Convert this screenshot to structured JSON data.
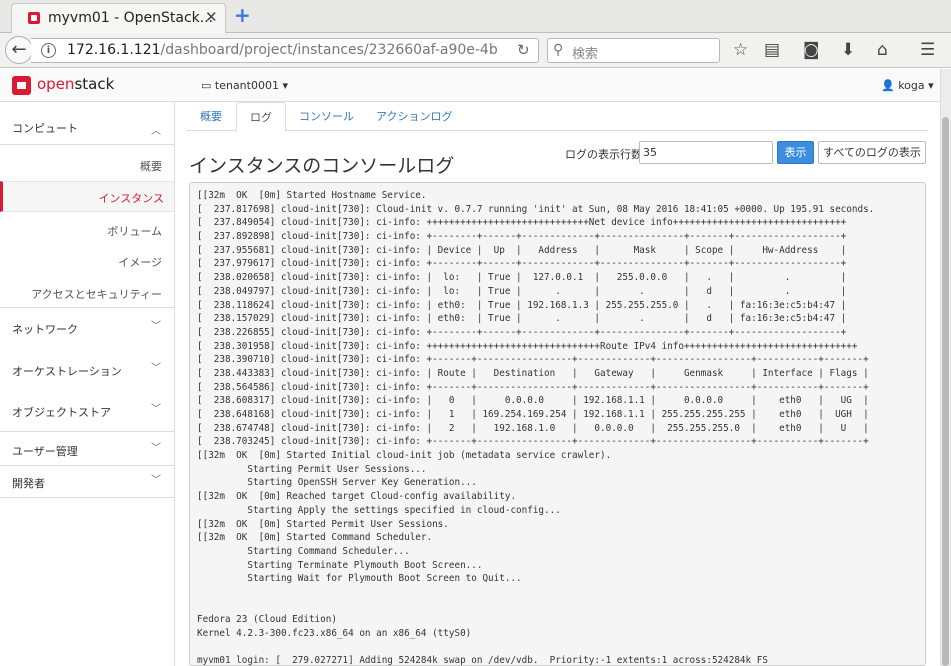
{
  "browser": {
    "tab_title": "myvm01 - OpenStack...",
    "close_glyph": "✕",
    "newtab_glyph": "+",
    "url_host": "172.16.1.121",
    "url_path": "/dashboard/project/instances/232660af-a90e-4b",
    "search_placeholder": "検索",
    "icons": [
      "star-icon",
      "reading-list-icon",
      "pocket-icon",
      "download-icon",
      "home-icon",
      "menu-icon"
    ]
  },
  "header": {
    "brand_prefix": "open",
    "brand_suffix": "stack",
    "tenant": "tenant0001 ▾",
    "user": "koga ▾"
  },
  "sidebar": {
    "compute": "コンピュート",
    "overview": "概要",
    "instances": "インスタンス",
    "volumes": "ボリューム",
    "images": "イメージ",
    "access": "アクセスとセキュリティー",
    "network": "ネットワーク",
    "orchestration": "オーケストレーション",
    "object_store": "オブジェクトストア",
    "identity": "ユーザー管理",
    "developer": "開発者"
  },
  "tabs": {
    "overview": "概要",
    "log": "ログ",
    "console": "コンソール",
    "action_log": "アクションログ"
  },
  "page": {
    "title": "インスタンスのコンソールログ",
    "lines_label": "ログの表示行数",
    "lines_value": "35",
    "show_button": "表示",
    "all_button": "すべてのログの表示"
  },
  "console_log": "[[32m  OK  [0m] Started Hostname Service.\n[  237.817698] cloud-init[730]: Cloud-init v. 0.7.7 running 'init' at Sun, 08 May 2016 18:41:05 +0000. Up 195.91 seconds.\n[  237.849054] cloud-init[730]: ci-info: +++++++++++++++++++++++++++++Net device info+++++++++++++++++++++++++++++++\n[  237.892898] cloud-init[730]: ci-info: +--------+------+-------------+---------------+-------+-------------------+\n[  237.955681] cloud-init[730]: ci-info: | Device |  Up  |   Address   |      Mask     | Scope |     Hw-Address    |\n[  237.979617] cloud-init[730]: ci-info: +--------+------+-------------+---------------+-------+-------------------+\n[  238.020658] cloud-init[730]: ci-info: |  lo:   | True |  127.0.0.1  |   255.0.0.0   |   .   |         .         |\n[  238.049797] cloud-init[730]: ci-info: |  lo:   | True |      .      |       .       |   d   |         .         |\n[  238.118624] cloud-init[730]: ci-info: | eth0:  | True | 192.168.1.3 | 255.255.255.0 |   .   | fa:16:3e:c5:b4:47 |\n[  238.157029] cloud-init[730]: ci-info: | eth0:  | True |      .      |       .       |   d   | fa:16:3e:c5:b4:47 |\n[  238.226855] cloud-init[730]: ci-info: +--------+------+-------------+---------------+-------+-------------------+\n[  238.301958] cloud-init[730]: ci-info: +++++++++++++++++++++++++++++++Route IPv4 info+++++++++++++++++++++++++++++++\n[  238.390710] cloud-init[730]: ci-info: +-------+-----------------+-------------+-----------------+-----------+-------+\n[  238.443383] cloud-init[730]: ci-info: | Route |   Destination   |   Gateway   |     Genmask     | Interface | Flags |\n[  238.564586] cloud-init[730]: ci-info: +-------+-----------------+-------------+-----------------+-----------+-------+\n[  238.608317] cloud-init[730]: ci-info: |   0   |     0.0.0.0     | 192.168.1.1 |     0.0.0.0     |    eth0   |   UG  |\n[  238.648168] cloud-init[730]: ci-info: |   1   | 169.254.169.254 | 192.168.1.1 | 255.255.255.255 |    eth0   |  UGH  |\n[  238.674748] cloud-init[730]: ci-info: |   2   |   192.168.1.0   |   0.0.0.0   |  255.255.255.0  |    eth0   |   U   |\n[  238.703245] cloud-init[730]: ci-info: +-------+-----------------+-------------+-----------------+-----------+-------+\n[[32m  OK  [0m] Started Initial cloud-init job (metadata service crawler).\n         Starting Permit User Sessions...\n         Starting OpenSSH Server Key Generation...\n[[32m  OK  [0m] Reached target Cloud-config availability.\n         Starting Apply the settings specified in cloud-config...\n[[32m  OK  [0m] Started Permit User Sessions.\n[[32m  OK  [0m] Started Command Scheduler.\n         Starting Command Scheduler...\n         Starting Terminate Plymouth Boot Screen...\n         Starting Wait for Plymouth Boot Screen to Quit...\n\n\nFedora 23 (Cloud Edition)\nKernel 4.2.3-300.fc23.x86_64 on an x86_64 (ttyS0)\n\nmyvm01 login: [  279.027271] Adding 524284k swap on /dev/vdb.  Priority:-1 extents:1 across:524284k FS",
  "colors": {
    "brand_red": "#da1a32",
    "link_blue": "#337ab7",
    "primary_button": "#3c8dde"
  }
}
